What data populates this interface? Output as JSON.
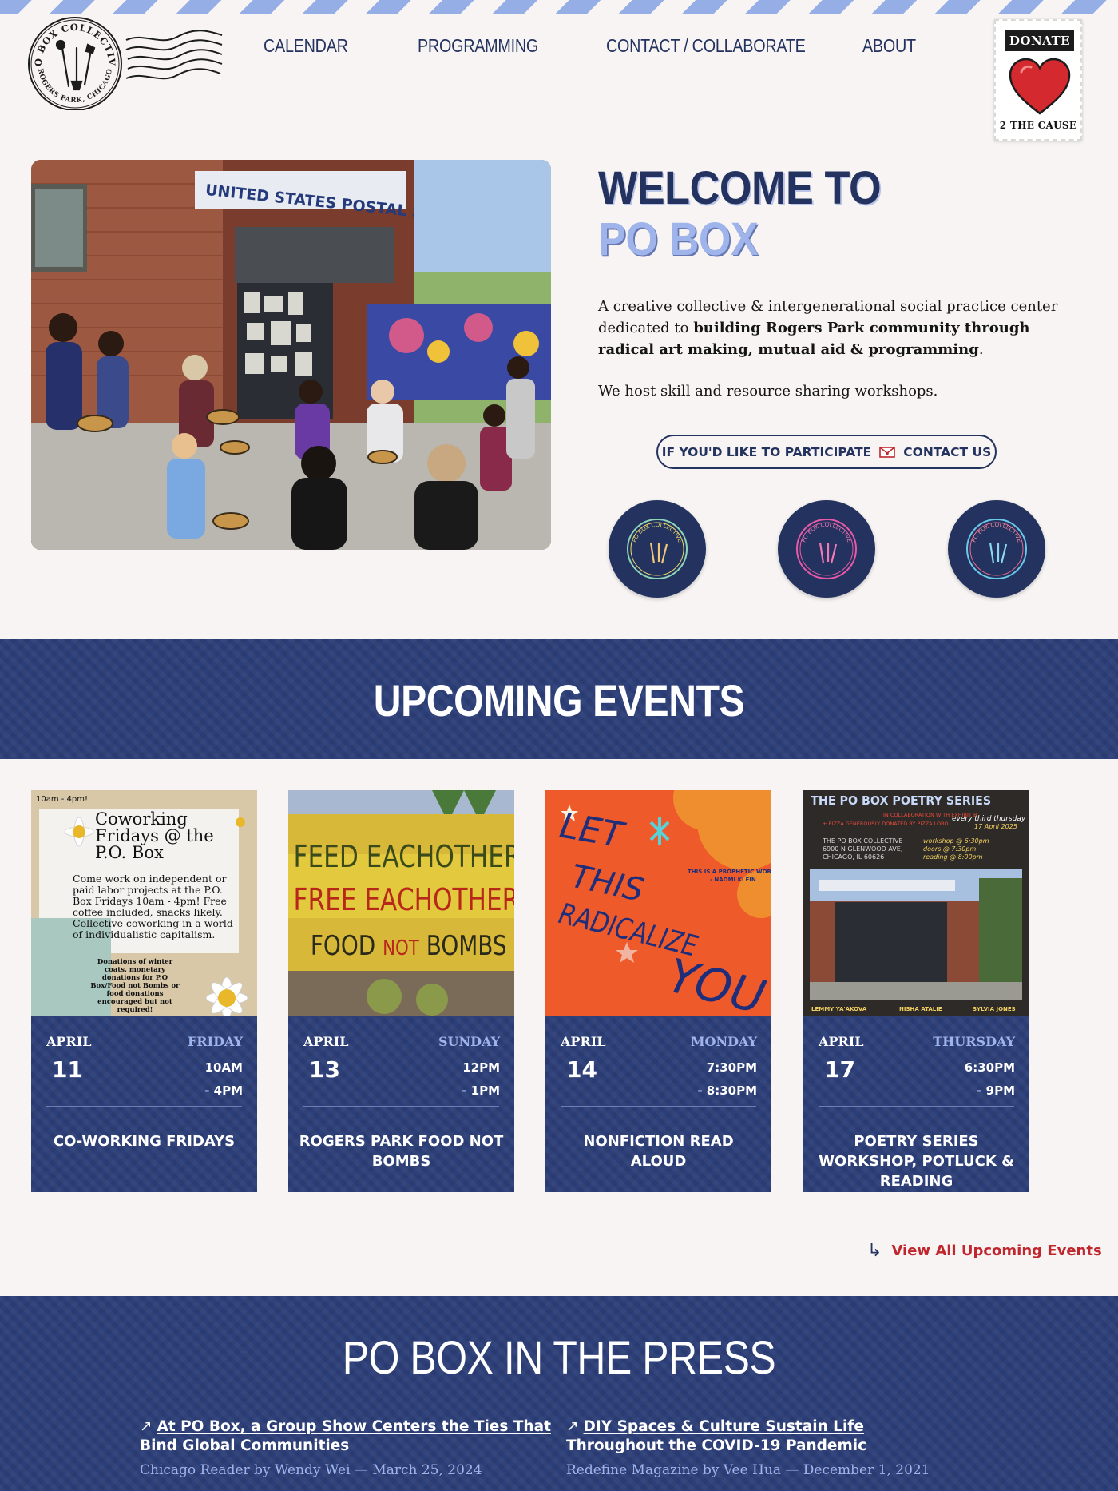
{
  "brand": {
    "logo_text_top": "PO BOX COLLECTIVE",
    "logo_text_bottom": "ROGERS PARK, CHICAGO",
    "accent": "#23325e",
    "light_accent": "#9fb4ea",
    "link_red": "#c0262d"
  },
  "nav": {
    "items": [
      {
        "label": "CALENDAR"
      },
      {
        "label": "PROGRAMMING"
      },
      {
        "label": "CONTACT / COLLABORATE"
      },
      {
        "label": "ABOUT"
      }
    ]
  },
  "donate": {
    "label": "DONATE",
    "caption": "2 THE CAUSE",
    "icon": "heart-icon"
  },
  "hero": {
    "image_sign": "UNITED STATES POSTAL SERVICE",
    "title_line1": "WELCOME TO",
    "title_line2": "PO BOX",
    "desc_part1": "A creative collective & intergenerational social practice center dedicated to ",
    "desc_bold": "building Rogers Park community through radical art making, mutual aid & programming",
    "desc_end": ".",
    "desc2": "We host skill and resource sharing workshops.",
    "cta_prefix": "IF YOU'D LIKE TO PARTICIPATE",
    "cta_suffix": "CONTACT US",
    "badge_text": "PO BOX COLLECTIVE"
  },
  "events": {
    "heading": "UPCOMING EVENTS",
    "view_all": "View All Upcoming Events",
    "items": [
      {
        "month": "APRIL",
        "day": "11",
        "weekday": "FRIDAY",
        "time_start": "10AM",
        "time_end": "4PM",
        "title": "CO-WORKING FRIDAYS",
        "poster": {
          "corner": "10am - 4pm!",
          "headline": "Coworking Fridays @ the P.O. Box",
          "body": "Come work on independent or paid labor projects at the P.O. Box Fridays 10am - 4pm! Free coffee included, snacks likely. Collective coworking in a world of individualistic capitalism.",
          "note": "Donations of winter coats, monetary donations for P.O Box/Food not Bombs or food donations encouraged but not required!"
        }
      },
      {
        "month": "APRIL",
        "day": "13",
        "weekday": "SUNDAY",
        "time_start": "12PM",
        "time_end": "1PM",
        "title": "ROGERS PARK FOOD NOT BOMBS",
        "poster": {
          "line1": "FEED EACHOTHER",
          "line2": "FREE EACHOTHER",
          "line3a": "FOOD ",
          "line3b": "NOT",
          "line3c": " BOMBS"
        }
      },
      {
        "month": "APRIL",
        "day": "14",
        "weekday": "MONDAY",
        "time_start": "7:30PM",
        "time_end": "8:30PM",
        "title": "NONFICTION READ ALOUD",
        "poster": {
          "w1": "LET",
          "w2": "THIS",
          "w3": "RADICALIZE",
          "w4": "YOU",
          "quote": "THIS IS A PROPHETIC WORK",
          "author": "- NAOMI KLEIN"
        }
      },
      {
        "month": "APRIL",
        "day": "17",
        "weekday": "THURSDAY",
        "time_start": "6:30PM",
        "time_end": "9PM",
        "title": "POETRY SERIES WORKSHOP, POTLUCK & READING",
        "poster": {
          "headline": "THE PO BOX POETRY SERIES",
          "collab": "IN COLLABORATION WITH EXHIBIT B",
          "pizza": "+ PIZZA GENEROUSLY DONATED BY PIZZA LOBO",
          "when": "every third thursday",
          "date": "17 April 2025",
          "address1": "THE PO BOX COLLECTIVE",
          "address2": "6900 N GLENWOOD AVE,",
          "address3": "CHICAGO, IL 60626",
          "sched1": "workshop @ 6:30pm",
          "sched2": "doors @ 7:30pm",
          "sched3": "reading @ 8:00pm",
          "readers": [
            "LEMMY YA'AKOVA",
            "NISHA ATALIE",
            "SYLVIA JONES"
          ]
        }
      }
    ]
  },
  "press": {
    "heading": "PO BOX IN THE PRESS",
    "items": [
      {
        "title": "At PO Box, a Group Show Centers the Ties That Bind Global Communities",
        "source": "Chicago Reader by Wendy Wei",
        "date": "March 25, 2024"
      },
      {
        "title": "DIY Spaces & Culture Sustain Life Throughout the COVID-19 Pandemic",
        "source": "Redefine Magazine by Vee Hua",
        "date": "December 1, 2021"
      }
    ]
  }
}
